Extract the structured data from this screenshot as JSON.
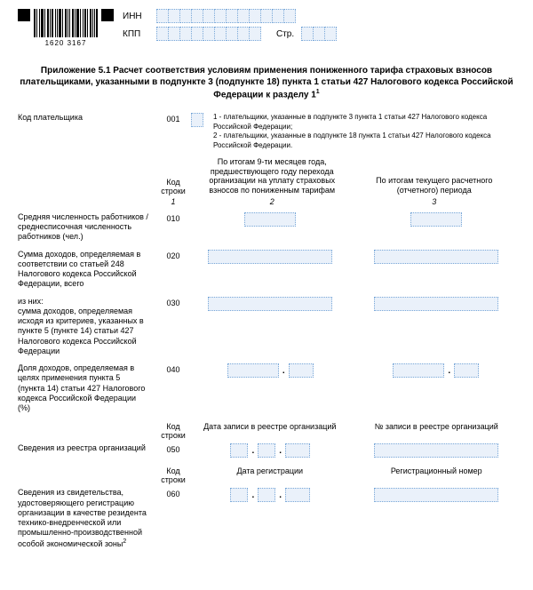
{
  "barcode_number": "1620 3167",
  "inn_label": "ИНН",
  "kpp_label": "КПП",
  "page_label": "Стр.",
  "title": "Приложение 5.1 Расчет соответствия условиям применения пониженного тарифа страховых взносов плательщиками, указанными в подпункте 3 (подпункте 18) пункта 1 статьи 427 Налогового кодекса Российской Федерации к разделу 1",
  "title_sup": "1",
  "payer_code_label": "Код плательщика",
  "payer_code_line": "001",
  "payer_notes": {
    "n1": "1 - плательщики, указанные в подпункте 3 пункта 1 статьи 427 Налогового кодекса Российской Федерации;",
    "n2": "2 - плательщики, указанные в подпункте 18 пункта 1 статьи 427 Налогового кодекса Российской Федерации."
  },
  "table_headers": {
    "code": "Код строки",
    "col2": "По итогам 9-ти месяцев года, предшествующего году перехода организации на уплату страховых взносов по пониженным тарифам",
    "col3": "По итогам текущего расчетного (отчетного) периода",
    "n1": "1",
    "n2": "2",
    "n3": "3"
  },
  "rows": {
    "r010": {
      "label": "Средняя численность работников / среднесписочная численность работников (чел.)",
      "code": "010"
    },
    "r020": {
      "label": "Сумма доходов, определяемая в соответствии со статьей 248 Налогового кодекса Российской Федерации, всего",
      "code": "020"
    },
    "r030": {
      "label": "из них:\nсумма доходов, определяемая исходя из критериев, указанных в пункте 5 (пункте 14) статьи 427 Налогового кодекса Российской Федерации",
      "code": "030"
    },
    "r040": {
      "label": "Доля доходов, определяемая в целях применения пункта 5 (пункта 14) статьи 427 Налогового кодекса Российской Федерации (%)",
      "code": "040"
    }
  },
  "registry_section": {
    "code_header": "Код строки",
    "date_header": "Дата записи в реестре организаций",
    "num_header": "№ записи в реестре организаций",
    "label": "Сведения из реестра организаций",
    "code": "050"
  },
  "cert_section": {
    "code_header": "Код строки",
    "date_header": "Дата регистрации",
    "num_header": "Регистрационный номер",
    "label": "Сведения из свидетельства, удостоверяющего регистрацию организации в качестве резидента технико-внедренческой или промышленно-производственной особой экономической зоны",
    "label_sup": "2",
    "code": "060"
  }
}
